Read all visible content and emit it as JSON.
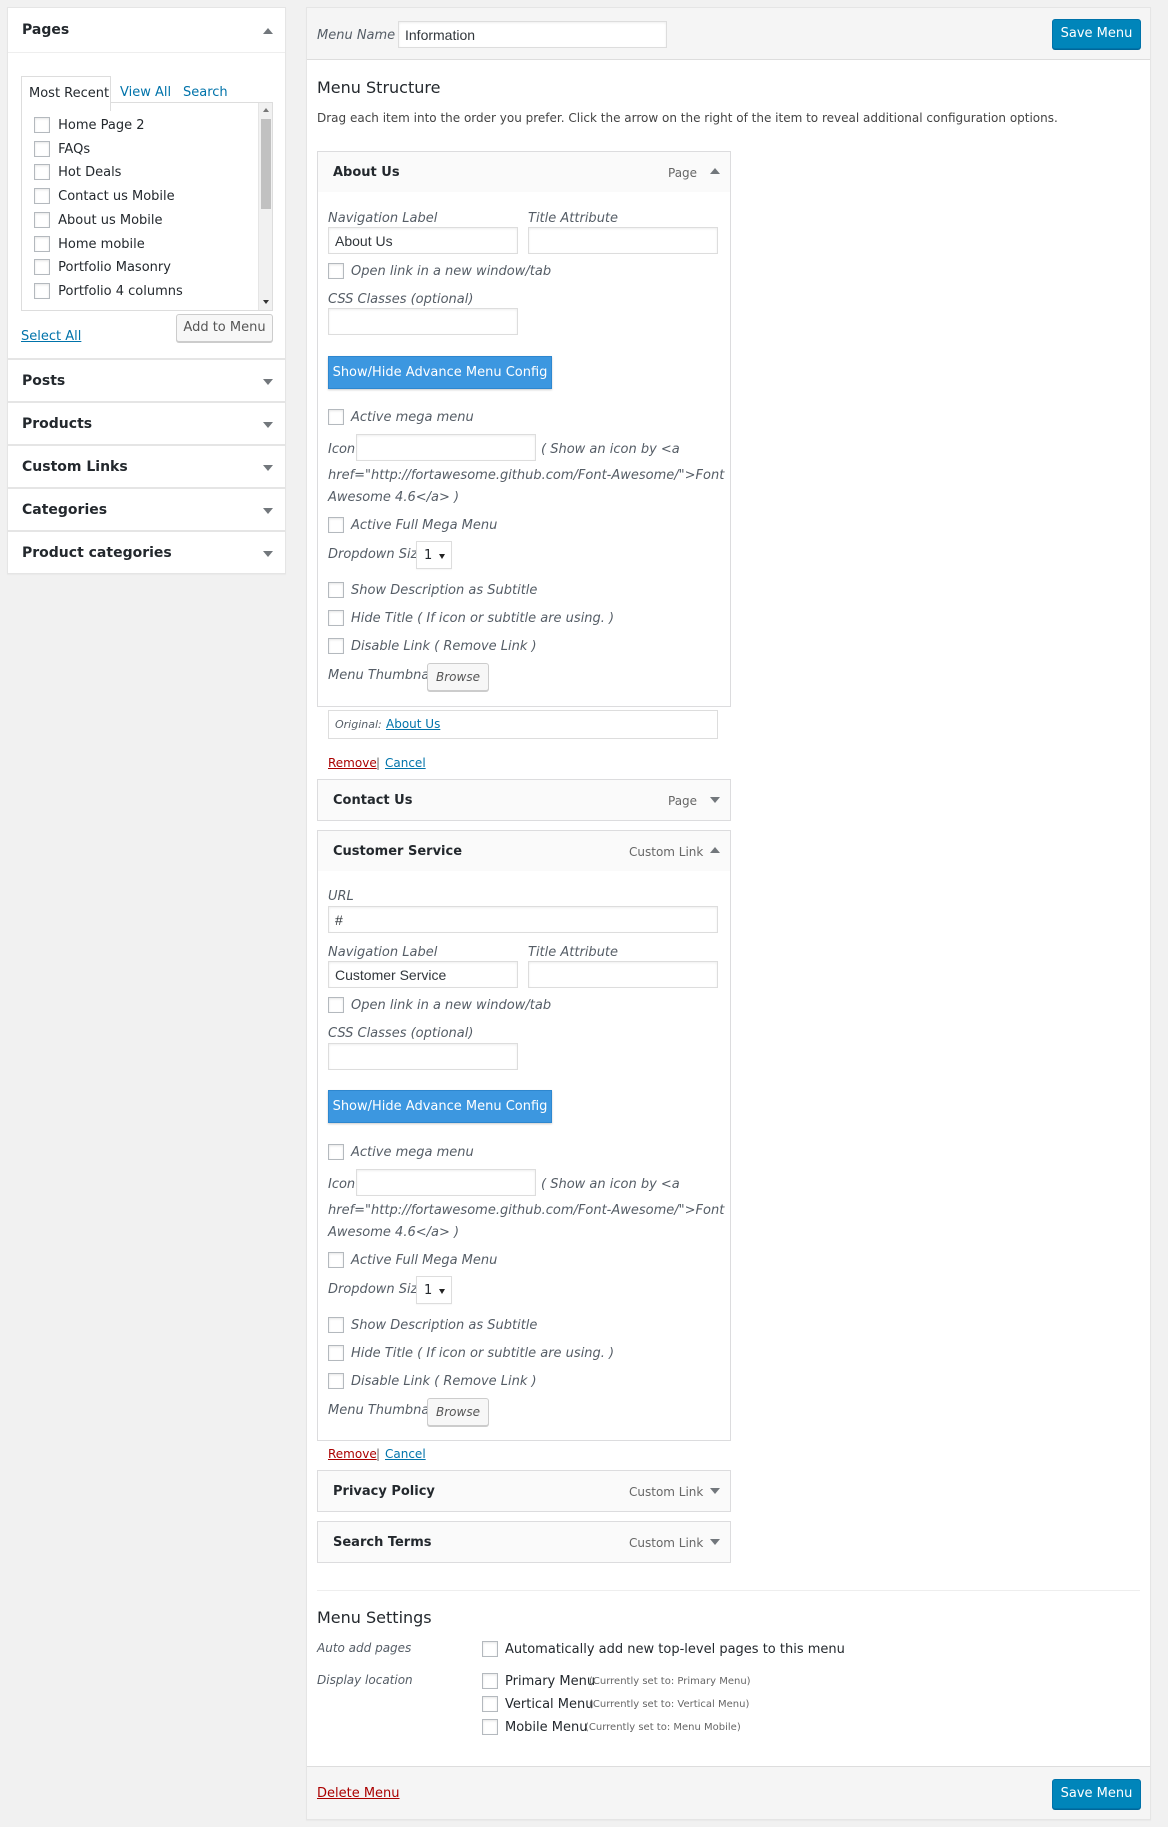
{
  "sidebar": {
    "pages": {
      "title": "Pages",
      "tabs": [
        "Most Recent",
        "View All",
        "Search"
      ],
      "items": [
        "Home Page 2",
        "FAQs",
        "Hot Deals",
        "Contact us Mobile",
        "About us Mobile",
        "Home mobile",
        "Portfolio Masonry",
        "Portfolio 4 columns"
      ],
      "select_all": "Select All",
      "add_to_menu": "Add to Menu"
    },
    "sections": [
      "Posts",
      "Products",
      "Custom Links",
      "Categories",
      "Product categories"
    ]
  },
  "header": {
    "menu_name_label": "Menu Name",
    "menu_name_value": "Information",
    "save_label": "Save Menu"
  },
  "structure": {
    "title": "Menu Structure",
    "description": "Drag each item into the order you prefer. Click the arrow on the right of the item to reveal additional configuration options."
  },
  "item_about": {
    "title": "About Us",
    "type": "Page",
    "nav_label": "Navigation Label",
    "nav_value": "About Us",
    "title_attr": "Title Attribute",
    "open_new": "Open link in a new window/tab",
    "css_classes": "CSS Classes (optional)",
    "advance_btn": "Show/Hide Advance Menu Config",
    "active_mega": "Active mega menu",
    "icon_label": "Icon",
    "icon_hint_1": "( Show an icon by <a",
    "icon_hint_2": "href=\"http://fortawesome.github.com/Font-Awesome/\">Font",
    "icon_hint_3": "Awesome 4.6</a> )",
    "active_full": "Active Full Mega Menu",
    "dropdown_label": "Dropdown Size",
    "dropdown_value": "1",
    "show_desc": "Show Description as Subtitle",
    "hide_title": "Hide Title ( If icon or subtitle are using. )",
    "disable_link": "Disable Link ( Remove Link )",
    "thumbnail": "Menu Thumbnail",
    "browse": "Browse",
    "original_label": "Original:",
    "original_link": "About Us",
    "remove": "Remove",
    "sep": "|",
    "cancel": "Cancel"
  },
  "item_contact": {
    "title": "Contact Us",
    "type": "Page"
  },
  "item_customer": {
    "title": "Customer Service",
    "type": "Custom Link",
    "url_label": "URL",
    "url_value": "#",
    "nav_label": "Navigation Label",
    "nav_value": "Customer Service",
    "title_attr": "Title Attribute",
    "open_new": "Open link in a new window/tab",
    "css_classes": "CSS Classes (optional)",
    "advance_btn": "Show/Hide Advance Menu Config",
    "active_mega": "Active mega menu",
    "icon_label": "Icon",
    "icon_hint_1": "( Show an icon by <a",
    "icon_hint_2": "href=\"http://fortawesome.github.com/Font-Awesome/\">Font",
    "icon_hint_3": "Awesome 4.6</a> )",
    "active_full": "Active Full Mega Menu",
    "dropdown_label": "Dropdown Size",
    "dropdown_value": "1",
    "show_desc": "Show Description as Subtitle",
    "hide_title": "Hide Title ( If icon or subtitle are using. )",
    "disable_link": "Disable Link ( Remove Link )",
    "thumbnail": "Menu Thumbnail",
    "browse": "Browse",
    "remove": "Remove",
    "sep": "|",
    "cancel": "Cancel"
  },
  "item_privacy": {
    "title": "Privacy Policy",
    "type": "Custom Link"
  },
  "item_search": {
    "title": "Search Terms",
    "type": "Custom Link"
  },
  "settings": {
    "title": "Menu Settings",
    "auto_add_label": "Auto add pages",
    "auto_add_text": "Automatically add new top-level pages to this menu",
    "display_label": "Display location",
    "locations": [
      {
        "name": "Primary Menu",
        "note": "(Currently set to: Primary Menu)"
      },
      {
        "name": "Vertical Menu",
        "note": "(Currently set to: Vertical Menu)"
      },
      {
        "name": "Mobile Menu",
        "note": "(Currently set to: Menu Mobile)"
      }
    ]
  },
  "footer": {
    "delete_label": "Delete Menu",
    "save_label": "Save Menu"
  }
}
